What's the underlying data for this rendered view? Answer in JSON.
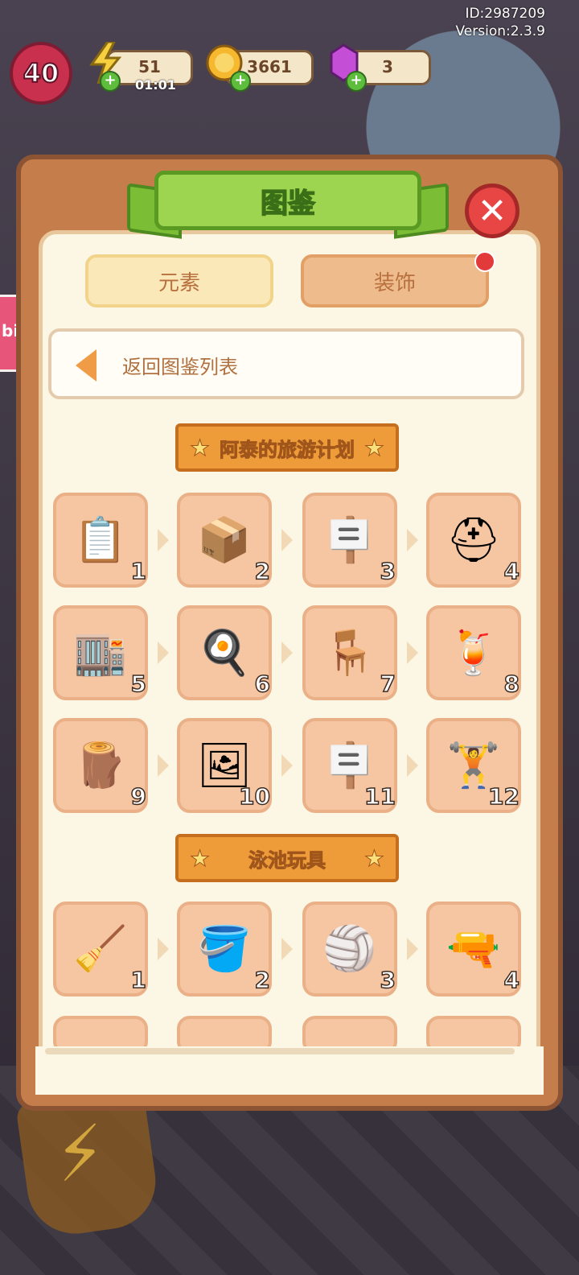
{
  "hud": {
    "id_text": "ID:2987209",
    "version_text": "Version:2.3.9",
    "level": "40",
    "energy": "51",
    "timer": "01:01",
    "coins": "3661",
    "gems": "3"
  },
  "modal": {
    "title": "图鉴",
    "tabs": {
      "elements": "元素",
      "decorations": "装饰"
    },
    "back_label": "返回图鉴列表"
  },
  "sections": [
    {
      "title": "阿泰的旅游计划",
      "items": [
        {
          "num": "1",
          "icon": "clipboard-icon",
          "glyph": "📋"
        },
        {
          "num": "2",
          "icon": "boxes-icon",
          "glyph": "📦"
        },
        {
          "num": "3",
          "icon": "closed-sign-icon",
          "glyph": "🪧"
        },
        {
          "num": "4",
          "icon": "helmet-icon",
          "glyph": "⛑"
        },
        {
          "num": "5",
          "icon": "building-icon",
          "glyph": "🏬"
        },
        {
          "num": "6",
          "icon": "frying-pan-icon",
          "glyph": "🍳"
        },
        {
          "num": "7",
          "icon": "lifeguard-chair-icon",
          "glyph": "🪑"
        },
        {
          "num": "8",
          "icon": "juice-icon",
          "glyph": "🍹"
        },
        {
          "num": "9",
          "icon": "woodpile-icon",
          "glyph": "🪵"
        },
        {
          "num": "10",
          "icon": "photos-icon",
          "glyph": "🖼"
        },
        {
          "num": "11",
          "icon": "open-sign-icon",
          "glyph": "🪧"
        },
        {
          "num": "12",
          "icon": "gym-logo-icon",
          "glyph": "🏋"
        }
      ]
    },
    {
      "title": "泳池玩具",
      "items": [
        {
          "num": "1",
          "icon": "sand-shovel-icon",
          "glyph": "🧹"
        },
        {
          "num": "2",
          "icon": "sand-bucket-icon",
          "glyph": "🪣"
        },
        {
          "num": "3",
          "icon": "beach-ball-icon",
          "glyph": "🏐"
        },
        {
          "num": "4",
          "icon": "water-gun-icon",
          "glyph": "🔫"
        }
      ]
    }
  ],
  "colors": {
    "accent": "#ee9b3a",
    "tile": "#f6c6a2",
    "title_green": "#9ed550"
  }
}
